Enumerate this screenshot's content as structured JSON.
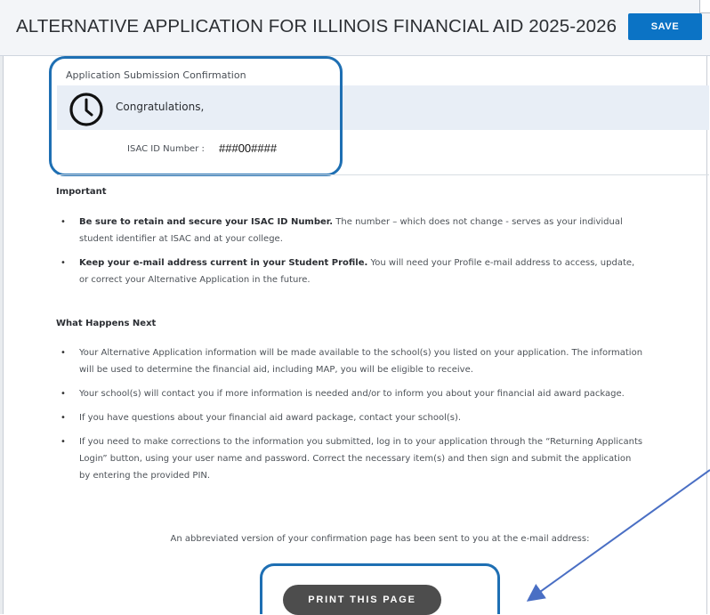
{
  "header": {
    "title": "ALTERNATIVE APPLICATION FOR ILLINOIS FINANCIAL AID 2025-2026",
    "save_label": "SAVE"
  },
  "confirmation": {
    "label": "Application Submission Confirmation",
    "icon": "clock-icon",
    "congrats": "Congratulations,",
    "isac_label": "ISAC ID Number :",
    "isac_value": "###00####"
  },
  "important": {
    "heading": "Important",
    "items": [
      {
        "bold": "Be sure to retain and secure your ISAC ID Number.",
        "text": " The number – which does not change - serves as your individual student identifier at ISAC and at your college."
      },
      {
        "bold": "Keep your e-mail address current in your Student Profile.",
        "text": " You will need your Profile e-mail address to access, update, or correct your Alternative Application in the future."
      }
    ]
  },
  "next": {
    "heading": "What Happens Next",
    "items": [
      "Your Alternative Application information will be made available to the school(s) you listed on your application. The information will be used to determine the financial aid, including MAP, you will be eligible to receive.",
      "Your school(s) will contact you if more information is needed and/or to inform you about your financial aid award package.",
      "If you have questions about your financial aid award package, contact your school(s).",
      "If you need to make corrections to the information you submitted, log in to your application through the “Returning Applicants Login” button, using your user name and password. Correct the necessary item(s) and then sign and submit the application by entering the provided PIN."
    ]
  },
  "abbreviated": "An abbreviated version of your confirmation page has been sent to you at the e-mail address:",
  "print_label": "PRINT THIS PAGE",
  "colors": {
    "save_button": "#0b73c5",
    "highlight": "#1e6fb3",
    "print_button": "#4d4d4d",
    "panel": "#e8eef6"
  }
}
